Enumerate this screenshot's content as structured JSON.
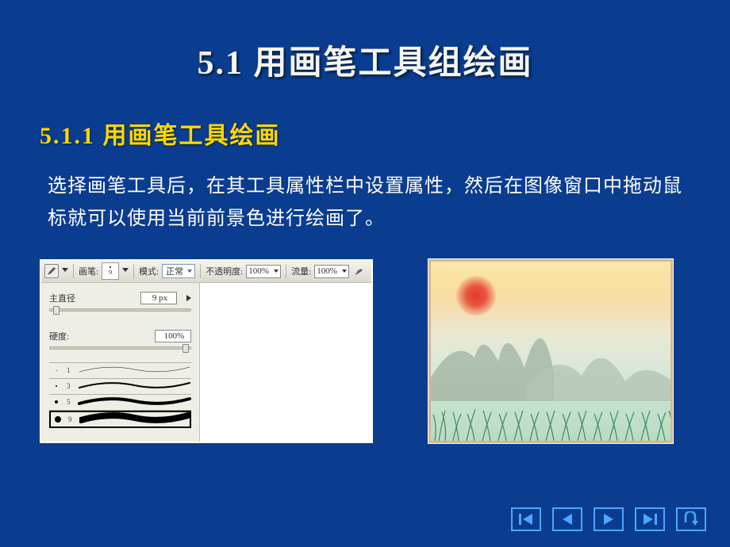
{
  "slide": {
    "main_title": "5.1  用画笔工具组绘画",
    "sub_title": "5.1.1  用画笔工具绘画",
    "body_text": "选择画笔工具后，在其工具属性栏中设置属性，然后在图像窗口中拖动鼠标就可以使用当前前景色进行绘画了。"
  },
  "toolbar": {
    "brush_word": "画笔:",
    "brush_preview_size": "9",
    "mode_label": "模式:",
    "mode_value": "正常",
    "opacity_label": "不透明度:",
    "opacity_value": "100%",
    "flow_label": "流量:",
    "flow_value": "100%"
  },
  "panel": {
    "diameter_label": "主直径",
    "diameter_value": "9 px",
    "hardness_label": "硬度:",
    "hardness_value": "100%",
    "brushes": [
      {
        "size": "1",
        "weight": 0.5
      },
      {
        "size": "3",
        "weight": 2
      },
      {
        "size": "5",
        "weight": 4
      },
      {
        "size": "9",
        "weight": 8,
        "selected": true
      }
    ]
  },
  "nav": {
    "first": "first",
    "prev": "previous",
    "next": "next",
    "last": "last",
    "return": "return"
  }
}
